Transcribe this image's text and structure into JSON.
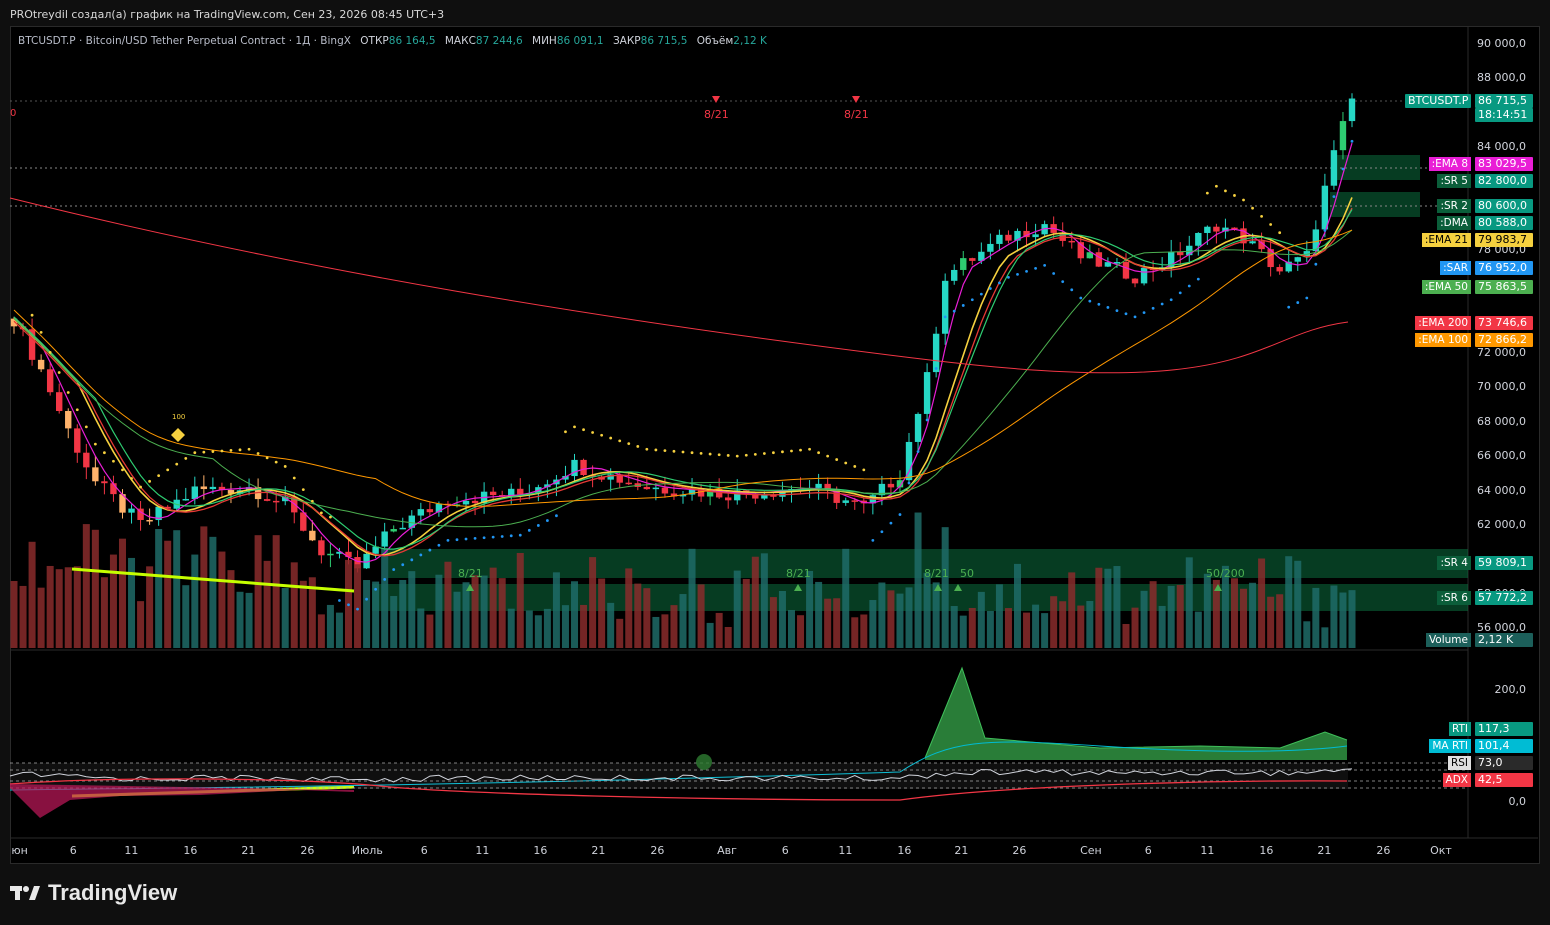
{
  "caption": "PROtreydil создал(а) график на TradingView.com, Сен 23, 2026 08:45 UTC+3",
  "legend": {
    "symbol_line": "BTCUSDT.P · Bitcoin/USD Tether Perpetual Contract · 1Д · BingX",
    "open_label": "ОТКР",
    "open": "86 164,5",
    "high_label": "МАКС",
    "high": "87 244,6",
    "low_label": "МИН",
    "low": "86 091,1",
    "close_label": "ЗАКР",
    "close": "86 715,5",
    "volume_label": "Объём",
    "volume": "2,12 K"
  },
  "left_stub": "0",
  "price_axis": [
    "90 000,0",
    "88 000,0",
    "84 000,0",
    "78 000,0",
    "72 000,0",
    "70 000,0",
    "68 000,0",
    "66 000,0",
    "64 000,0",
    "62 000,0",
    "58 000,0",
    "56 000,0"
  ],
  "indicator_axis": [
    "200,0",
    "0,0"
  ],
  "time_axis": [
    "юн",
    "6",
    "11",
    "16",
    "21",
    "26",
    "Июль",
    "6",
    "11",
    "16",
    "21",
    "26",
    "Авг",
    "6",
    "11",
    "16",
    "21",
    "26",
    "Сен",
    "6",
    "11",
    "16",
    "21",
    "26",
    "Окт"
  ],
  "price_tag": {
    "name": "BTCUSDT.P",
    "value": "86 715,5",
    "countdown": "18:14:51"
  },
  "level_tags": [
    {
      "name": ":EMA 8",
      "value": "83 029,5",
      "color": "#e91ed6"
    },
    {
      "name": ":SR 5",
      "value": "82 800,0",
      "color": "#089981"
    },
    {
      "name": ":SR 2",
      "value": "80 600,0",
      "color": "#089981"
    },
    {
      "name": ":DMA",
      "value": "80 588,0",
      "color": "#089981"
    },
    {
      "name": ":EMA 21",
      "value": "79 983,7",
      "color": "#f5d03f"
    },
    {
      "name": ":SAR",
      "value": "76 952,0",
      "color": "#2196f3"
    },
    {
      "name": ":EMA 50",
      "value": "75 863,5",
      "color": "#4caf50"
    },
    {
      "name": ":EMA 200",
      "value": "73 746,6",
      "color": "#f23645"
    },
    {
      "name": ":EMA 100",
      "value": "72 866,2",
      "color": "#ff9800"
    },
    {
      "name": ":SR 4",
      "value": "59 809,1",
      "color": "#089981"
    },
    {
      "name": ":SR 6",
      "value": "57 772,2",
      "color": "#089981"
    },
    {
      "name": "Volume",
      "value": "2,12 K",
      "color": "#26a69a"
    }
  ],
  "indicator_tags": [
    {
      "name": "RTI",
      "value": "117,3",
      "color": "#089981"
    },
    {
      "name": "MA RTI",
      "value": "101,4",
      "color": "#00bcd4"
    },
    {
      "name": "RSI",
      "value": "73,0",
      "color": "#d1d4dc"
    },
    {
      "name": "ADX",
      "value": "42,5",
      "color": "#f23645"
    }
  ],
  "signals": [
    "8/21",
    "8/21",
    "8/21",
    "8/21",
    "8/21",
    "50",
    "50/200"
  ],
  "ema_marker": "100",
  "logo": "TradingView",
  "colors": {
    "up": "#26d7c5",
    "up_alt": "#2ecc71",
    "down": "#f23645",
    "down_light": "#ffb26b",
    "ema8": "#e91ed6",
    "ema21": "#f5d03f",
    "ema50": "#4caf50",
    "ema100": "#ff9800",
    "ema200": "#f23645",
    "sar": "#2196f3",
    "trend": "#c6ff00"
  }
}
